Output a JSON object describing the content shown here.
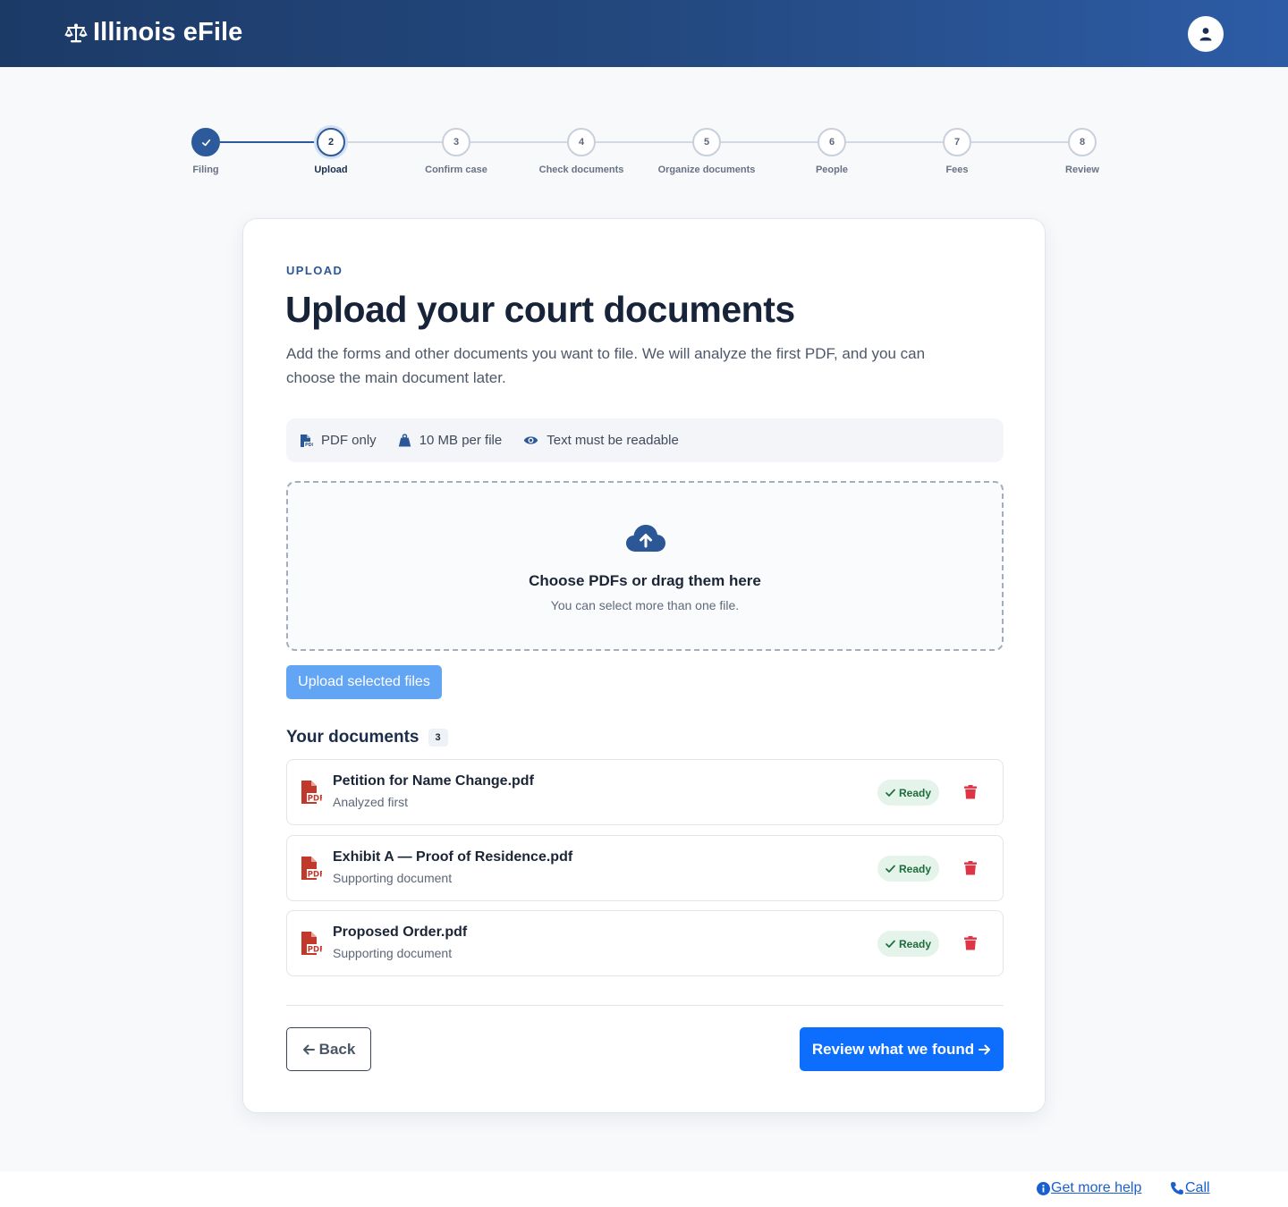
{
  "header": {
    "brand": "Illinois eFile",
    "brand_icon": "scale-balance-icon",
    "account_icon": "user-icon"
  },
  "stepper": {
    "steps": [
      {
        "number": "1",
        "label": "Filing",
        "state": "completed"
      },
      {
        "number": "2",
        "label": "Upload",
        "state": "active"
      },
      {
        "number": "3",
        "label": "Confirm case",
        "state": "pending"
      },
      {
        "number": "4",
        "label": "Check documents",
        "state": "pending"
      },
      {
        "number": "5",
        "label": "Organize documents",
        "state": "pending"
      },
      {
        "number": "6",
        "label": "People",
        "state": "pending"
      },
      {
        "number": "7",
        "label": "Fees",
        "state": "pending"
      },
      {
        "number": "8",
        "label": "Review",
        "state": "pending"
      }
    ]
  },
  "card": {
    "eyebrow": "UPLOAD",
    "title": "Upload your court documents",
    "description": "Add the forms and other documents you want to file. We will analyze the first PDF, and you can choose the main document later.",
    "requirements": [
      {
        "icon": "pdf-file-icon",
        "text": "PDF only"
      },
      {
        "icon": "weight-icon",
        "text": "10 MB per file"
      },
      {
        "icon": "eye-icon",
        "text": "Text must be readable"
      }
    ],
    "dropzone": {
      "icon": "cloud-upload-icon",
      "title": "Choose PDFs or drag them here",
      "subtitle": "You can select more than one file."
    },
    "upload_button": "Upload selected files",
    "documents_heading": "Your documents",
    "documents_count": "3",
    "documents": [
      {
        "name": "Petition for Name Change.pdf",
        "subtitle": "Analyzed first",
        "status": "Ready"
      },
      {
        "name": "Exhibit A — Proof of Residence.pdf",
        "subtitle": "Supporting document",
        "status": "Ready"
      },
      {
        "name": "Proposed Order.pdf",
        "subtitle": "Supporting document",
        "status": "Ready"
      }
    ],
    "back_button": "Back",
    "next_button": "Review what we found"
  },
  "footer": {
    "help_link": "Get more help",
    "call_link": "Call"
  },
  "colors": {
    "header_start": "#1c3a66",
    "header_end": "#2d5ca6",
    "accent": "#2d5a9a",
    "primary_button": "#0d6efd",
    "upload_button": "#63a5f5",
    "ready_badge_bg": "#e5f4ea",
    "ready_badge_text": "#1e6b3c",
    "delete_red": "#dc3545",
    "pdf_red": "#c0392b"
  }
}
